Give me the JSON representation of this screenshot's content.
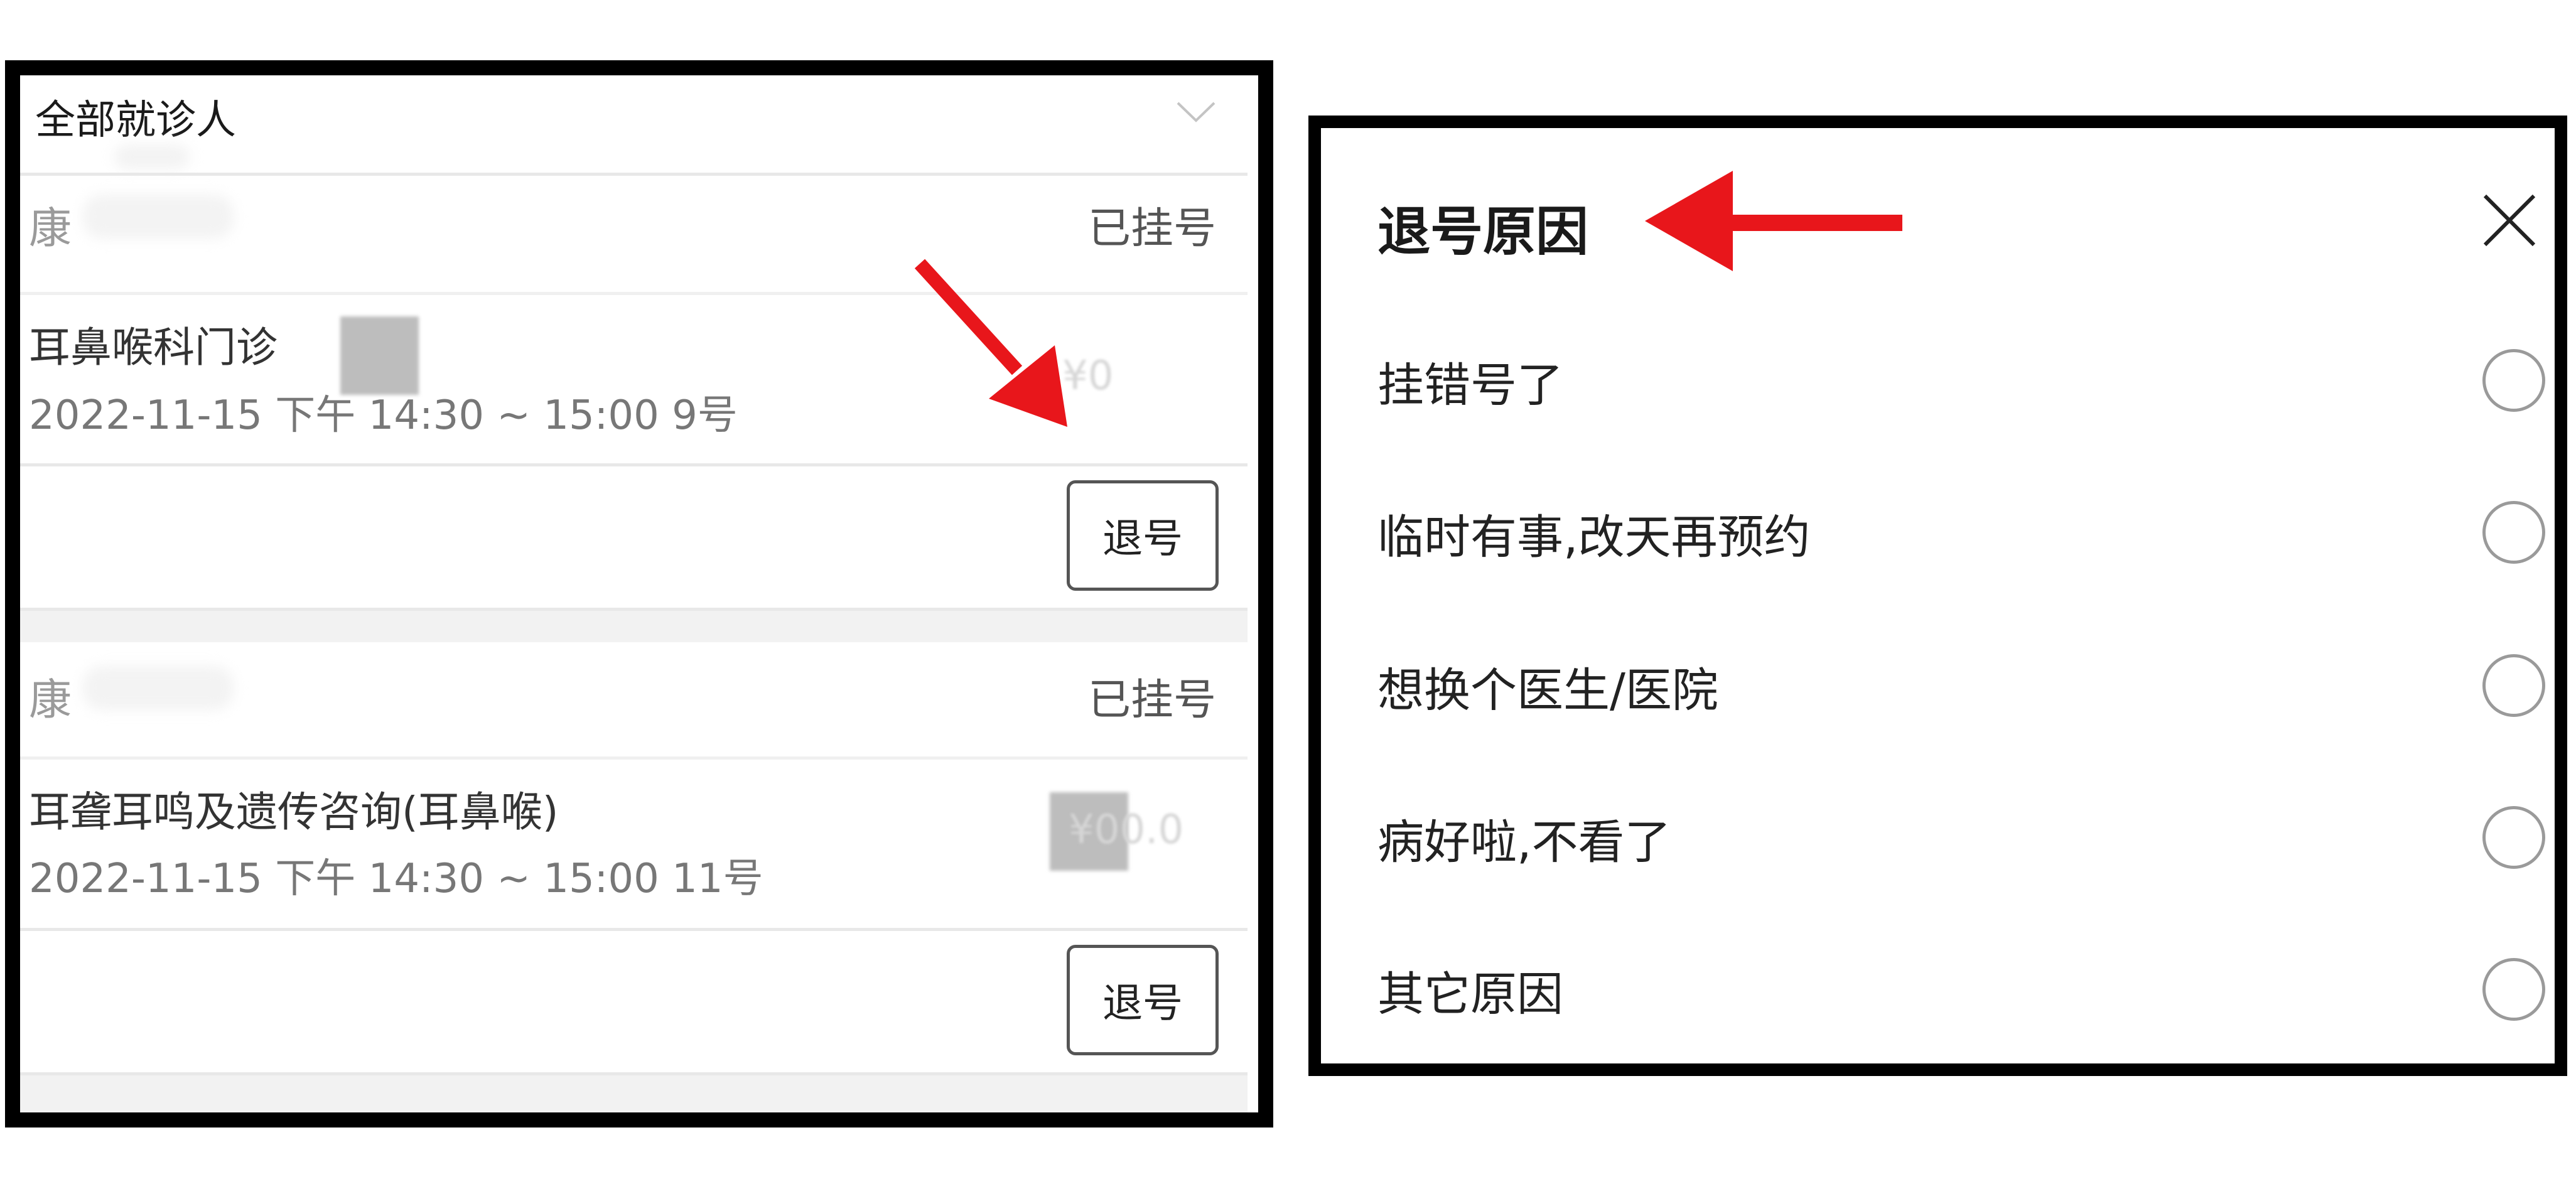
{
  "appointments_panel": {
    "filter": {
      "label": "全部就诊人",
      "chevron_icon": "chevron-down-icon"
    },
    "appointments": [
      {
        "patient_name_visible": "康",
        "status": "已挂号",
        "department": "耳鼻喉科门诊",
        "datetime": "2022-11-15 下午 14:30 ~ 15:00 9号",
        "price_visible": "¥0",
        "cancel_label": "退号"
      },
      {
        "patient_name_visible": "康",
        "status": "已挂号",
        "department": "耳聋耳鸣及遗传咨询(耳鼻喉)",
        "datetime": "2022-11-15 下午 14:30 ~ 15:00 11号",
        "price_visible": "¥00.0",
        "cancel_label": "退号"
      }
    ]
  },
  "cancel_reason_modal": {
    "title": "退号原因",
    "close_icon": "close-icon",
    "reasons": [
      {
        "label": "挂错号了",
        "selected": false
      },
      {
        "label": "临时有事,改天再预约",
        "selected": false
      },
      {
        "label": "想换个医生/医院",
        "selected": false
      },
      {
        "label": "病好啦,不看了",
        "selected": false
      },
      {
        "label": "其它原因",
        "selected": false
      }
    ]
  },
  "annotations": {
    "arrow_color": "#e8161b"
  },
  "colors": {
    "frame": "#000000",
    "divider": "#e8e8e8",
    "section_gap": "#f2f2f2",
    "status_text": "#555555",
    "muted_text": "#777777",
    "radio_border": "#9a9a9a"
  }
}
